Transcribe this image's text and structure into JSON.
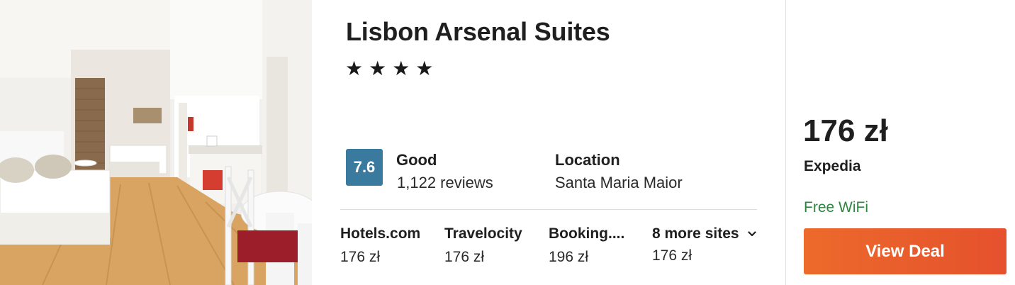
{
  "hotel": {
    "name": "Lisbon Arsenal Suites",
    "stars_display": "★★★★",
    "star_count": 4,
    "score": "7.6",
    "rating_word": "Good",
    "reviews": "1,122 reviews",
    "location_label": "Location",
    "location": "Santa Maria Maior"
  },
  "sites": [
    {
      "name": "Hotels.com",
      "price": "176 zł"
    },
    {
      "name": "Travelocity",
      "price": "176 zł"
    },
    {
      "name": "Booking....",
      "price": "196 zł"
    },
    {
      "name": "8 more sites",
      "price": "176 zł"
    }
  ],
  "deal": {
    "price": "176 zł",
    "provider": "Expedia",
    "amenity": "Free WiFi",
    "button_label": "View Deal"
  },
  "colors": {
    "score_badge": "#3a7a9e",
    "amenity_text": "#2e8540",
    "cta_start": "#ec6a2b",
    "cta_end": "#e5512d"
  },
  "icons": {
    "more_sites": "chevron-down-icon"
  }
}
